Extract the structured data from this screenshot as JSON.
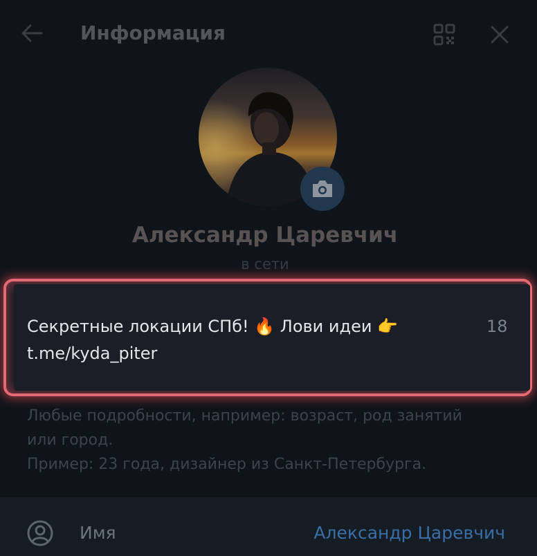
{
  "header": {
    "title": "Информация",
    "back_icon": "arrow-left-icon",
    "qr_icon": "qr-code-icon",
    "close_icon": "close-icon"
  },
  "profile": {
    "name": "Александр Царевчич",
    "status": "в сети",
    "camera_icon": "camera-icon"
  },
  "bio": {
    "line1_part1": "Секретные локации СПб! ",
    "line1_part2": " Лови идеи ",
    "line2": "t.me/kyda_piter",
    "char_count": "18",
    "emoji_fire": "🔥",
    "emoji_point": "👉"
  },
  "hint": {
    "line1": "Любые подробности, например: возраст, род занятий",
    "line2": "или город.",
    "line3": "Пример: 23 года, дизайнер из Санкт-Петербурга."
  },
  "name_field": {
    "label": "Имя",
    "value": "Александр Царевчич"
  },
  "colors": {
    "background": "#151c24",
    "highlight": "#e36a73",
    "accent": "#3a6ea6"
  }
}
